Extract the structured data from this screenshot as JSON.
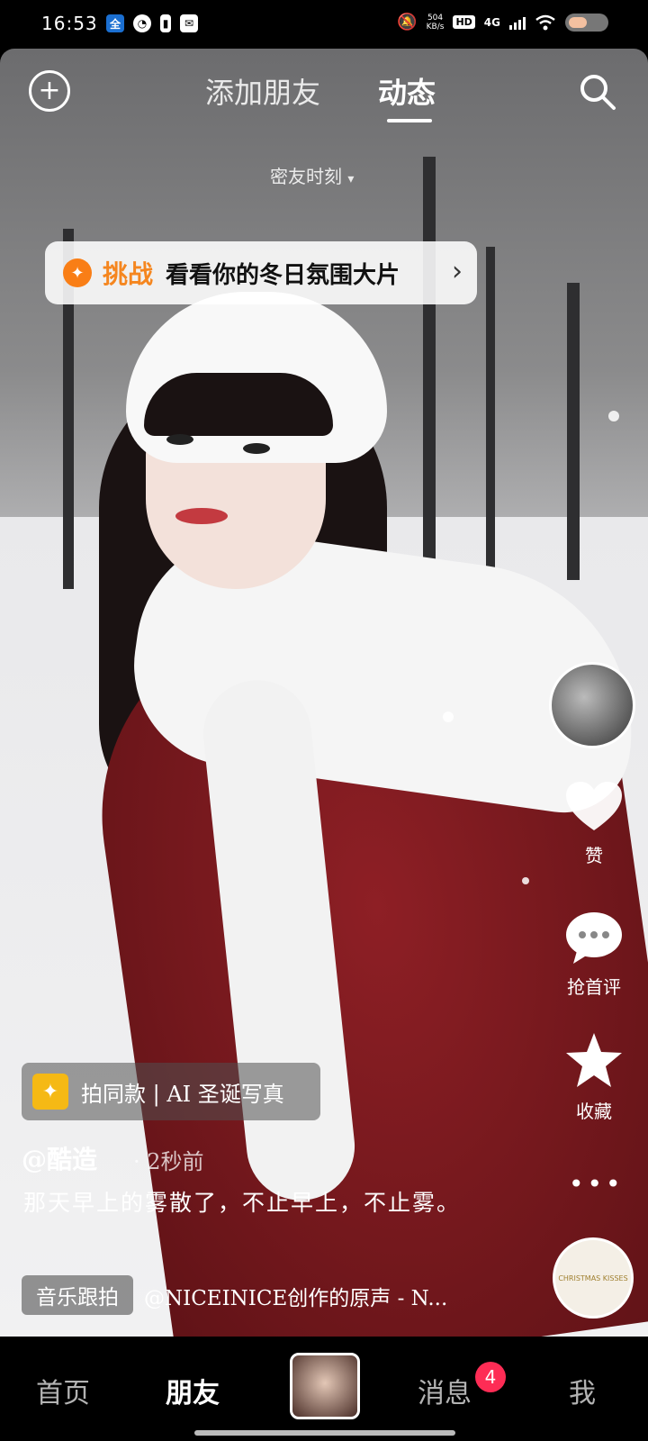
{
  "status_bar": {
    "time": "16:53",
    "net_speed_value": "504",
    "net_speed_unit": "KB/s",
    "hd": "HD",
    "network": "4G",
    "left_icons": [
      "bank-app-icon",
      "speedometer-icon",
      "battery-small-icon",
      "mail-icon"
    ],
    "right_icons": [
      "mute-bell-icon",
      "hd-icon",
      "signal-icon",
      "wifi-icon",
      "battery-icon"
    ]
  },
  "header": {
    "tab_add_friends": "添加朋友",
    "tab_feed": "动态",
    "subtitle": "密友时刻"
  },
  "challenge": {
    "tag": "挑战",
    "text": "看看你的冬日氛围大片"
  },
  "right_rail": {
    "like_label": "赞",
    "comment_label": "抢首评",
    "favorite_label": "收藏",
    "disc_text": "CHRISTMAS KISSES"
  },
  "post": {
    "remix_text": "拍同款 | AI 圣诞写真",
    "author": "@酷造",
    "time": "· 2秒前",
    "description": "那天早上的雾散了，不止早上，不止雾。",
    "music_tag": "音乐跟拍",
    "music_text": "@NICEINICE创作的原声 - N..."
  },
  "bottom_nav": {
    "home": "首页",
    "friends": "朋友",
    "messages": "消息",
    "messages_badge": "4",
    "me": "我"
  },
  "colors": {
    "accent_orange": "#f5861f",
    "badge_red": "#fe2c55",
    "remix_yellow": "#f5b915"
  }
}
